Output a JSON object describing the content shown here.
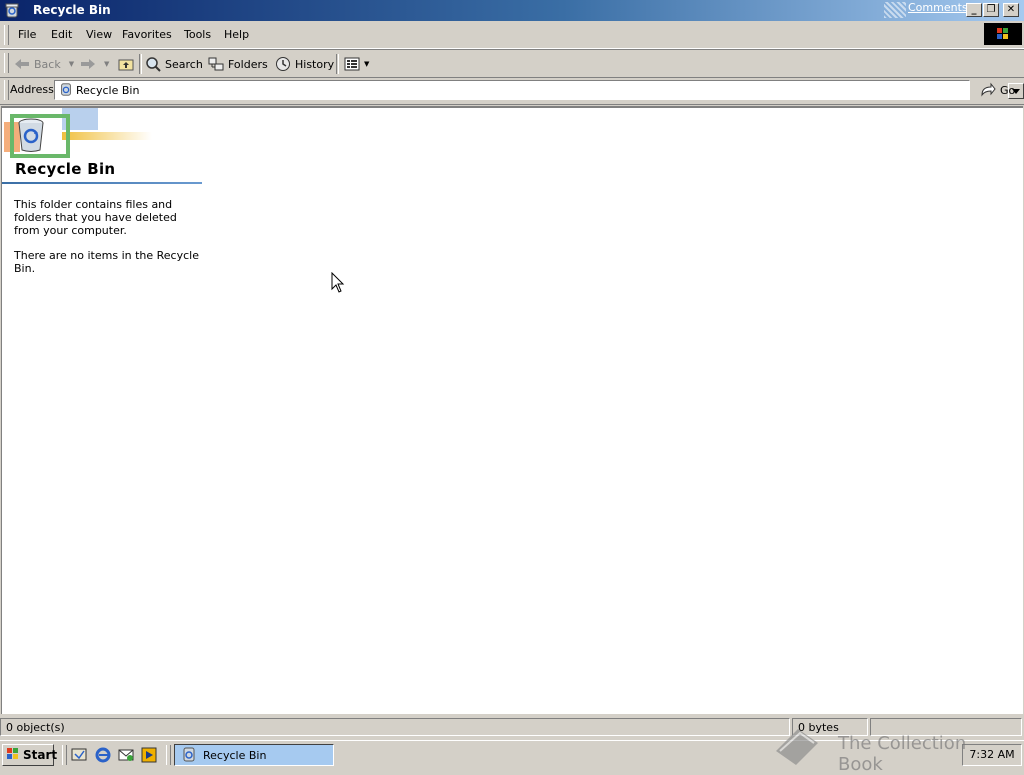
{
  "window": {
    "title": "Recycle Bin",
    "comments_link": "Comments?",
    "minimize_glyph": "_",
    "restore_glyph": "❐",
    "close_glyph": "✕"
  },
  "menu": {
    "items": [
      "File",
      "Edit",
      "View",
      "Favorites",
      "Tools",
      "Help"
    ]
  },
  "toolbar": {
    "back": "Back",
    "search": "Search",
    "folders": "Folders",
    "history": "History"
  },
  "address": {
    "label": "Address",
    "value": "Recycle Bin",
    "go": "Go"
  },
  "content": {
    "heading": "Recycle Bin",
    "description": "This folder contains files and folders that you have deleted from your computer.",
    "empty_message": "There are no items in the Recycle Bin."
  },
  "status": {
    "objects": "0 object(s)",
    "size": "0 bytes"
  },
  "taskbar": {
    "start": "Start",
    "task_label": "Recycle Bin",
    "clock": "7:32 AM"
  },
  "watermark": {
    "text": "The Collection Book"
  },
  "colors": {
    "title_bar": "#0a246a",
    "chrome": "#d4d0c8",
    "accent_rule": "#3a6ea5"
  },
  "icons": {
    "app": "recycle-bin-icon",
    "back": "back-arrow-icon",
    "forward": "forward-arrow-icon",
    "up": "up-folder-icon",
    "search": "search-icon",
    "folders": "folders-icon",
    "history": "history-icon",
    "views": "views-icon",
    "go": "go-arrow-icon"
  }
}
